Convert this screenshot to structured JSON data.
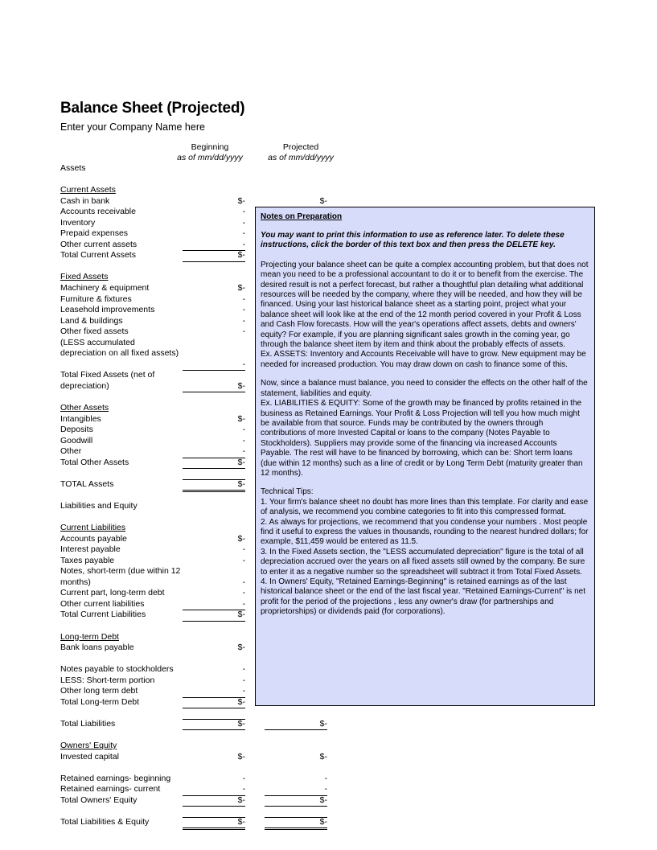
{
  "document": {
    "title": "Balance Sheet (Projected)",
    "company_placeholder": "Enter your Company Name here"
  },
  "columns": {
    "beginning": {
      "label": "Beginning",
      "sub": "as of mm/dd/yyyy"
    },
    "projected": {
      "label": "Projected",
      "sub": "as of mm/dd/yyyy"
    }
  },
  "symbols": {
    "dollar_zero": "$-",
    "dash": "-"
  },
  "sections": {
    "assets_header": "Assets",
    "current_assets_header": "Current Assets",
    "fixed_assets_header": "Fixed Assets",
    "other_assets_header": "Other Assets",
    "liabilities_equity_header": "Liabilities and Equity",
    "current_liabilities_header": "Current Liabilities",
    "long_term_debt_header": "Long-term Debt",
    "owners_equity_header": "Owners' Equity"
  },
  "lines": {
    "cash_in_bank": "Cash in bank",
    "accounts_receivable": "Accounts receivable",
    "inventory": "Inventory",
    "prepaid_expenses": "Prepaid expenses",
    "other_current_assets": "Other current assets",
    "total_current_assets": "Total Current Assets",
    "machinery_equipment": "Machinery & equipment",
    "furniture_fixtures": "Furniture & fixtures",
    "leasehold_improvements": "Leasehold improvements",
    "land_buildings": "Land & buildings",
    "other_fixed_assets": "Other fixed assets",
    "less_accumulated_depreciation": "(LESS accumulated depreciation on all fixed assets)",
    "total_fixed_assets": "Total Fixed Assets (net of depreciation)",
    "intangibles": "Intangibles",
    "deposits": "Deposits",
    "goodwill": "Goodwill",
    "other": "Other",
    "total_other_assets": "Total Other Assets",
    "total_assets": "TOTAL Assets",
    "accounts_payable": "Accounts payable",
    "interest_payable": "Interest payable",
    "taxes_payable": "Taxes payable",
    "notes_short_term": "Notes, short-term (due within 12 months)",
    "current_part_long_term_debt": "Current part, long-term debt",
    "other_current_liabilities": "Other current liabilities",
    "total_current_liabilities": "Total Current Liabilities",
    "bank_loans_payable": "Bank loans payable",
    "notes_payable_stockholders": "Notes payable to stockholders",
    "less_short_term_portion": "LESS: Short-term portion",
    "other_long_term_debt": "Other long term debt",
    "total_long_term_debt": "Total Long-term Debt",
    "total_liabilities": "Total Liabilities",
    "invested_capital": "Invested capital",
    "retained_earnings_beginning": "Retained earnings- beginning",
    "retained_earnings_current": "Retained earnings- current",
    "total_owners_equity": "Total Owners' Equity",
    "total_liabilities_equity": "Total Liabilities & Equity"
  },
  "notes": {
    "title": "Notes on Preparation",
    "emphasis": "You may want to print this information to use as reference later.  To delete these instructions, click the border of this text box and then press the DELETE key.",
    "paragraph_1": "Projecting your balance sheet can be quite a complex accounting problem, but that does not mean you need to be a professional accountant to do it or to benefit from the exercise. The desired result is not a perfect forecast, but rather a thoughtful plan detailing what additional resources will be needed by the company, where they will be needed, and how they will be financed. Using your last historical balance sheet as a starting point, project what your balance sheet will look like at the end of the 12 month period covered in your Profit & Loss and Cash Flow forecasts. How will the year's operations affect assets, debts and owners' equity?  For example, if you are planning significant sales growth in the coming year, go through the balance sheet item by item and think about the probably effects of assets.",
    "example_assets": "Ex. ASSETS: Inventory and Accounts Receivable will have to grow.  New equipment may be needed for increased production. You may draw down on cash to finance some of this.",
    "paragraph_2": "Now, since a balance must balance, you need to consider the effects on the other half of the statement, liabilities and equity.",
    "example_liabilities": "Ex. LIABILITIES & EQUITY: Some of the growth may be financed by profits retained in the business as Retained Earnings. Your Profit & Loss Projection will tell you how much might be available from that source. Funds may be contributed by the owners through contributions of more Invested Capital or loans to the company (Notes Payable to Stockholders). Suppliers may provide some of the financing via increased Accounts Payable. The rest will have to be financed by borrowing, which can be: Short term loans (due within 12 months) such as a line of credit or by Long Term Debt (maturity greater than 12 months).",
    "technical_tips_title": "Technical Tips:",
    "tip_1": "1. Your firm's balance sheet no doubt has more lines than this template. For clarity and ease of analysis, we recommend you combine categories to fit into this compressed format.",
    "tip_2": "2. As always for projections, we recommend that you condense your numbers . Most people find it useful to express the values in thousands, rounding to the nearest hundred dollars; for example, $11,459 would be entered as  11.5.",
    "tip_3": "3. In the Fixed Assets section, the \"LESS accumulated depreciation\" figure is the total of all depreciation accrued over the years on all fixed assets still owned by the company. Be sure to enter it as a negative number so the spreadsheet will subtract it from Total Fixed Assets.",
    "tip_4": "4. In Owners' Equity, \"Retained Earnings-Beginning\" is retained earnings as of the last historical balance sheet or the end of the last fiscal year. \"Retained Earnings-Current\" is net profit for the period of the projections , less any owner's draw (for partnerships and proprietorships) or dividends paid (for corporations)."
  },
  "colors": {
    "notes_background": "#d8dcfb",
    "notes_border": "#000000",
    "text": "#000000",
    "page_background": "#ffffff"
  }
}
